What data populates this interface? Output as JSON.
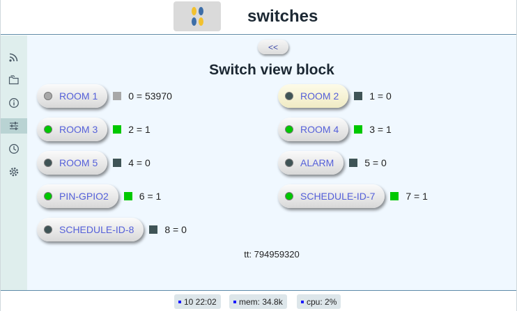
{
  "header": {
    "title": "switches"
  },
  "sidebar": {
    "items": [
      {
        "icon": "rss-icon"
      },
      {
        "icon": "folder-icon"
      },
      {
        "icon": "info-icon"
      },
      {
        "icon": "sliders-icon",
        "active": true
      },
      {
        "icon": "clock-icon"
      },
      {
        "icon": "gear-icon"
      }
    ]
  },
  "main": {
    "back_label": "<<",
    "title": "Switch view block",
    "switches": [
      {
        "label": "ROOM 1",
        "value": "0 = 53970",
        "led": "#a8a8a8",
        "box": "#a8a8a8",
        "highlight": false
      },
      {
        "label": "ROOM 2",
        "value": "1 = 0",
        "led": "#3f5456",
        "box": "#3f5456",
        "highlight": true
      },
      {
        "label": "ROOM 3",
        "value": "2 = 1",
        "led": "#00c800",
        "box": "#00c800",
        "highlight": false
      },
      {
        "label": "ROOM 4",
        "value": "3 = 1",
        "led": "#00c800",
        "box": "#00c800",
        "highlight": false
      },
      {
        "label": "ROOM 5",
        "value": "4 = 0",
        "led": "#3f5456",
        "box": "#3f5456",
        "highlight": false
      },
      {
        "label": "ALARM",
        "value": "5 = 0",
        "led": "#3f5456",
        "box": "#3f5456",
        "highlight": false
      },
      {
        "label": "PIN-GPIO2",
        "value": "6 = 1",
        "led": "#00c800",
        "box": "#00c800",
        "highlight": false
      },
      {
        "label": "SCHEDULE-ID-7",
        "value": "7 = 1",
        "led": "#00c800",
        "box": "#00c800",
        "highlight": false
      },
      {
        "label": "SCHEDULE-ID-8",
        "value": "8 = 0",
        "led": "#3f5456",
        "box": "#3f5456",
        "highlight": false
      }
    ],
    "tt": "tt: 794959320"
  },
  "footer": {
    "time": "10 22:02",
    "mem": "mem: 34.8k",
    "cpu": "cpu: 2%"
  }
}
